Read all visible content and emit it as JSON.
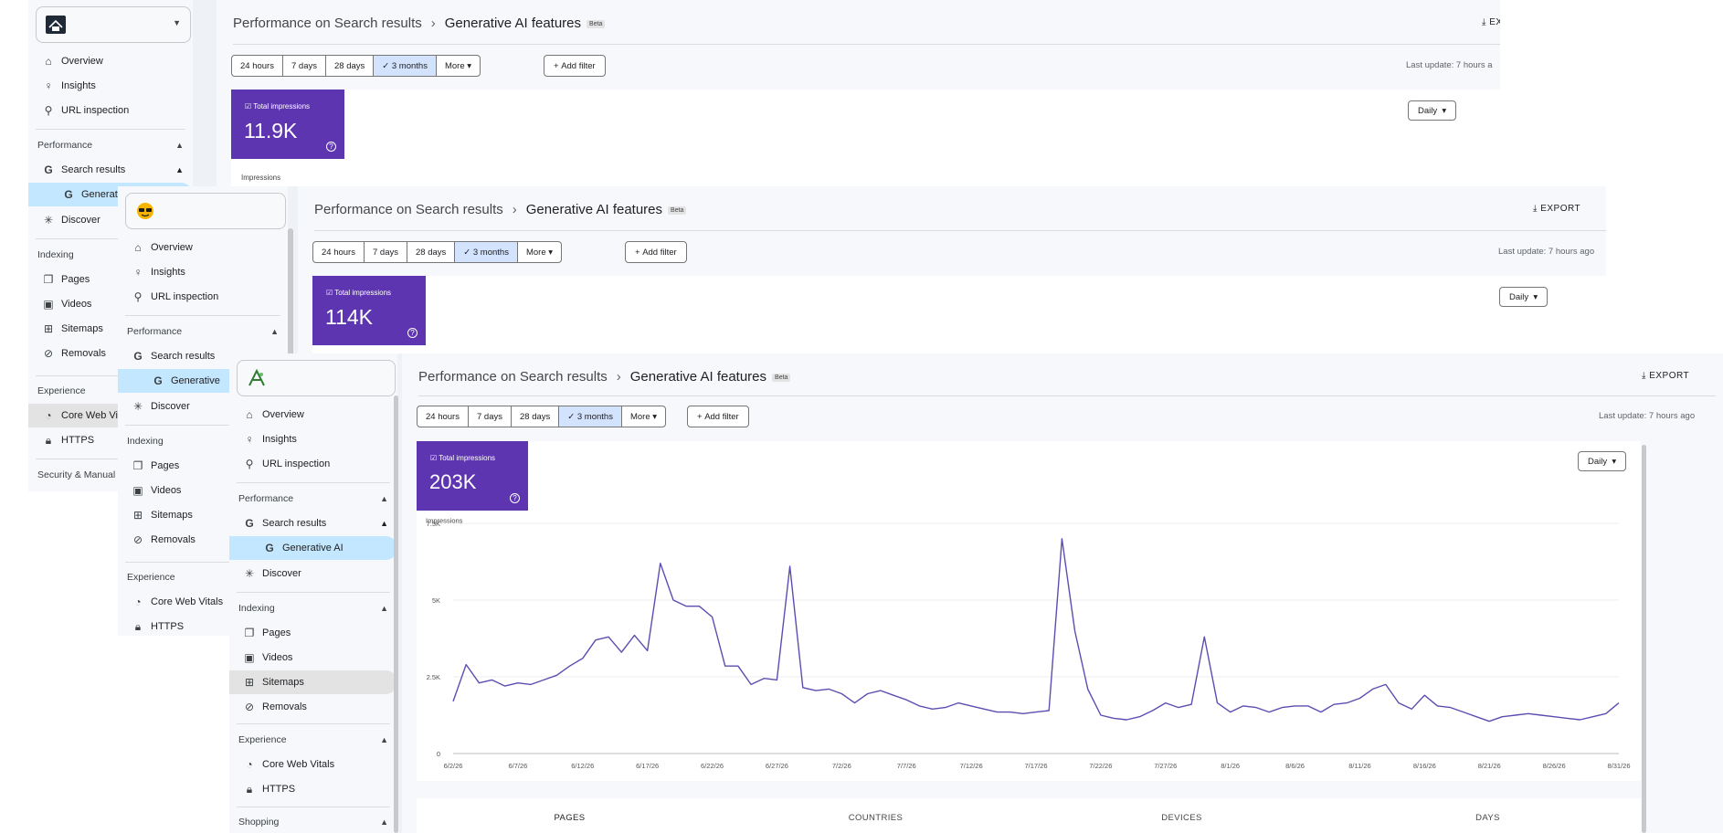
{
  "nav": {
    "overview": "Overview",
    "insights": "Insights",
    "url_inspection": "URL inspection",
    "performance": "Performance",
    "search_results": "Search results",
    "generative_full": "Generative AI",
    "generative_trunc": "Generati",
    "generative_trunc2": "Generative",
    "discover": "Discover",
    "indexing": "Indexing",
    "pages": "Pages",
    "videos": "Videos",
    "sitemaps": "Sitemaps",
    "removals": "Removals",
    "experience": "Experience",
    "core_web_vitals": "Core Web Vitals",
    "core_web_vitals_trunc": "Core Web Vita",
    "https": "HTTPS",
    "security": "Security & Manual",
    "shopping": "Shopping"
  },
  "header": {
    "crumb_parent": "Performance on Search results",
    "crumb_current": "Generative AI features",
    "beta": "Beta",
    "export": "EXPORT",
    "export_trunc": "EXPOR"
  },
  "filters": {
    "h24": "24 hours",
    "d7": "7 days",
    "d28": "28 days",
    "m3": "3 months",
    "more": "More",
    "add_filter": "Add filter",
    "last_update": "Last update: 7 hours ago",
    "last_update_trunc": "Last update: 7 hours a"
  },
  "metric_label": "Total impressions",
  "screens": {
    "back": {
      "total": "11.9K",
      "axis_label": "Impressions"
    },
    "mid": {
      "total": "114K"
    },
    "front": {
      "total": "203K"
    }
  },
  "granularity": "Daily",
  "tabs": [
    "PAGES",
    "COUNTRIES",
    "DEVICES",
    "DAYS"
  ],
  "colors": {
    "metric": "#5e35b1",
    "line": "#5c4db1",
    "active_nav": "#c2e7ff"
  },
  "chart_data": {
    "type": "line",
    "title": "",
    "ylabel": "Impressions",
    "xlabel": "",
    "ylim": [
      0,
      7500
    ],
    "yticks": [
      "0",
      "2.5K",
      "5K",
      "7.5K"
    ],
    "xticks": [
      "6/2/26",
      "6/7/26",
      "6/12/26",
      "6/17/26",
      "6/22/26",
      "6/27/26",
      "7/2/26",
      "7/7/26",
      "7/12/26",
      "7/17/26",
      "7/22/26",
      "7/27/26",
      "8/1/26",
      "8/6/26",
      "8/11/26",
      "8/16/26",
      "8/21/26",
      "8/26/26",
      "8/31/26"
    ],
    "grid": true,
    "series": [
      {
        "values": [
          1700,
          2900,
          2300,
          2400,
          2200,
          2300,
          2250,
          2400,
          2550,
          2850,
          3100,
          3700,
          3800,
          3300,
          3850,
          3350,
          6200,
          5000,
          4800,
          4800,
          4450,
          2850,
          2850,
          2250,
          2450,
          2400,
          6100,
          2150,
          2050,
          2100,
          1950,
          1650,
          1950,
          2050,
          1900,
          1750,
          1550,
          1450,
          1500,
          1650,
          1550,
          1450,
          1350,
          1350,
          1300,
          1350,
          1400,
          7000,
          4000,
          2100,
          1250,
          1150,
          1100,
          1200,
          1400,
          1650,
          1500,
          1600,
          3800,
          1650,
          1350,
          1550,
          1500,
          1350,
          1500,
          1550,
          1550,
          1350,
          1600,
          1650,
          1800,
          2100,
          2250,
          1650,
          1450,
          1900,
          1550,
          1500,
          1350,
          1200,
          1050,
          1200,
          1250,
          1300,
          1250,
          1200,
          1150,
          1100,
          1200,
          1300,
          1650
        ]
      }
    ]
  }
}
